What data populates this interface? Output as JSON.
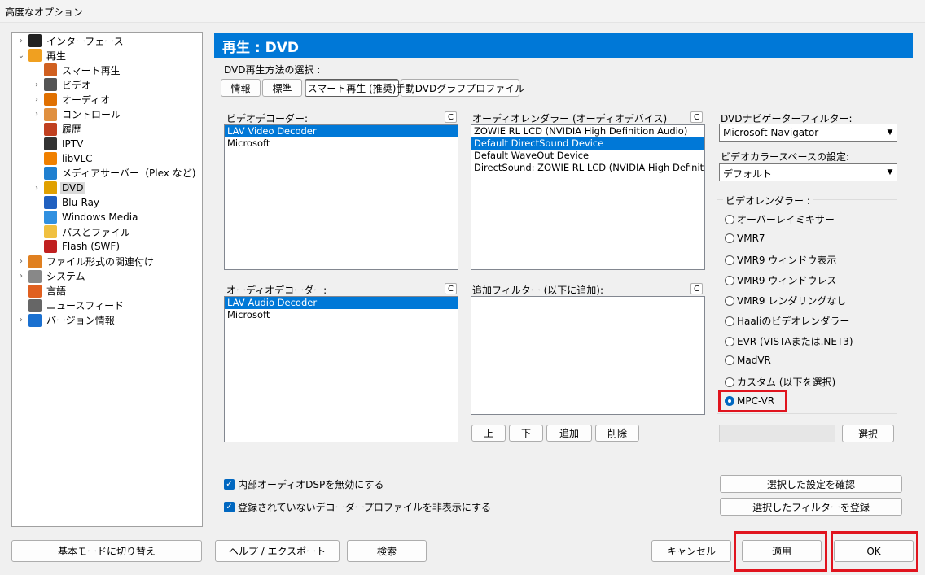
{
  "window": {
    "title": "高度なオプション"
  },
  "tree": [
    {
      "label": "インターフェース",
      "arrow": "›",
      "icon_color": "#222"
    },
    {
      "label": "再生",
      "arrow": "⌄",
      "icon_color": "#f0a020"
    },
    {
      "label": "スマート再生",
      "arrow": "",
      "icon_color": "#d06020"
    },
    {
      "label": "ビデオ",
      "arrow": "›",
      "icon_color": "#555"
    },
    {
      "label": "オーディオ",
      "arrow": "›",
      "icon_color": "#e07000"
    },
    {
      "label": "コントロール",
      "arrow": "›",
      "icon_color": "#e09040"
    },
    {
      "label": "履歴",
      "arrow": "",
      "icon_color": "#c04020"
    },
    {
      "label": "IPTV",
      "arrow": "",
      "icon_color": "#333"
    },
    {
      "label": "libVLC",
      "arrow": "",
      "icon_color": "#f08000"
    },
    {
      "label": "メディアサーバー（Plex など)",
      "arrow": "",
      "icon_color": "#2080d0"
    },
    {
      "label": "DVD",
      "arrow": "›",
      "icon_color": "#e0a000"
    },
    {
      "label": "Blu-Ray",
      "arrow": "",
      "icon_color": "#2060c0"
    },
    {
      "label": "Windows Media",
      "arrow": "",
      "icon_color": "#3090e0"
    },
    {
      "label": "パスとファイル",
      "arrow": "",
      "icon_color": "#f0c040"
    },
    {
      "label": "Flash (SWF)",
      "arrow": "",
      "icon_color": "#c02020"
    },
    {
      "label": "ファイル形式の関連付け",
      "arrow": "›",
      "icon_color": "#e08020"
    },
    {
      "label": "システム",
      "arrow": "›",
      "icon_color": "#888"
    },
    {
      "label": "言語",
      "arrow": "",
      "icon_color": "#e06020"
    },
    {
      "label": "ニュースフィード",
      "arrow": "",
      "icon_color": "#666"
    },
    {
      "label": "バージョン情報",
      "arrow": "›",
      "icon_color": "#1a70d0"
    }
  ],
  "header": {
    "title": "再生 : DVD"
  },
  "dvd_method": {
    "label": "DVD再生方法の選択 :",
    "tabs": [
      "情報",
      "標準",
      "スマート再生 (推奨)",
      "手動DVDグラフプロファイル"
    ]
  },
  "video_decoder": {
    "label": "ビデオデコーダー:",
    "c_label": "C",
    "items": [
      "LAV Video Decoder",
      "Microsoft"
    ]
  },
  "audio_renderer": {
    "label": "オーディオレンダラー (オーディオデバイス)",
    "c_label": "C",
    "items": [
      "ZOWIE RL LCD (NVIDIA High Definition Audio)",
      "Default DirectSound Device",
      "Default WaveOut Device",
      "DirectSound: ZOWIE RL LCD (NVIDIA High Definition A"
    ]
  },
  "audio_decoder": {
    "label": "オーディオデコーダー:",
    "c_label": "C",
    "items": [
      "LAV Audio Decoder",
      "Microsoft"
    ]
  },
  "extra_filter": {
    "label": "追加フィルター (以下に追加):",
    "c_label": "C",
    "buttons": [
      "上",
      "下",
      "追加",
      "削除"
    ]
  },
  "navigator": {
    "label": "DVDナビゲーターフィルター:",
    "value": "Microsoft Navigator"
  },
  "colorspace": {
    "label": "ビデオカラースペースの設定:",
    "value": "デフォルト"
  },
  "renderer": {
    "label": "ビデオレンダラー :",
    "options": [
      "オーバーレイミキサー",
      "VMR7",
      "VMR9 ウィンドウ表示",
      "VMR9 ウィンドウレス",
      "VMR9 レンダリングなし",
      "Haaliのビデオレンダラー",
      "EVR (VISTAまたは.NET3)",
      "MadVR",
      "カスタム (以下を選択)",
      "MPC-VR"
    ],
    "selected": "MPC-VR",
    "select_button": "選択"
  },
  "checks": [
    {
      "label": "内部オーディオDSPを無効にする",
      "checked": true
    },
    {
      "label": "登録されていないデコーダープロファイルを非表示にする",
      "checked": true
    }
  ],
  "right_buttons": [
    "選択した設定を確認",
    "選択したフィルターを登録"
  ],
  "footer": {
    "basic_mode": "基本モードに切り替え",
    "help_export": "ヘルプ / エクスポート",
    "search": "検索",
    "cancel": "キャンセル",
    "apply": "適用",
    "ok": "OK"
  },
  "colors": {
    "accent": "#0078d7",
    "highlight_box": "#e0141e"
  }
}
